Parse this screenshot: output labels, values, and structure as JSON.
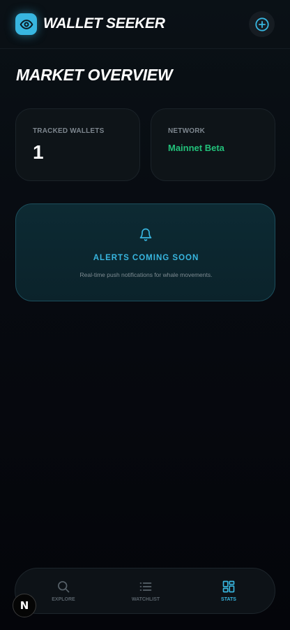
{
  "header": {
    "app_title": "WALLET SEEKER",
    "logo_icon": "eye-icon",
    "add_icon": "plus-circle-icon"
  },
  "main": {
    "page_title": "MARKET OVERVIEW",
    "stats": {
      "tracked_wallets": {
        "label": "TRACKED WALLETS",
        "value": "1"
      },
      "network": {
        "label": "NETWORK",
        "value": "Mainnet Beta"
      }
    },
    "alerts_card": {
      "icon": "bell-icon",
      "title": "ALERTS COMING SOON",
      "description": "Real-time push notifications for whale movements."
    }
  },
  "bottom_nav": {
    "items": [
      {
        "label": "EXPLORE",
        "icon": "search-icon",
        "active": false
      },
      {
        "label": "WATCHLIST",
        "icon": "list-icon",
        "active": false
      },
      {
        "label": "STATS",
        "icon": "grid-icon",
        "active": true
      }
    ]
  },
  "dev_badge": {
    "label": "N"
  },
  "colors": {
    "accent": "#38b6e0",
    "network_green": "#22c07a",
    "background": "#070a10"
  }
}
